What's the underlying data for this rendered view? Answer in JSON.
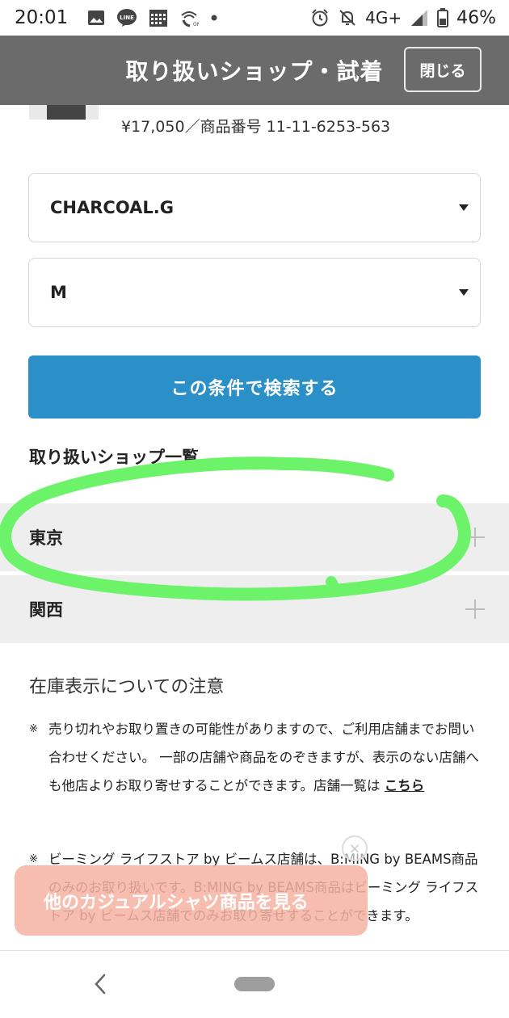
{
  "status_bar": {
    "time": "20:01",
    "network": "4G+",
    "battery": "46%",
    "icons": [
      "gallery-icon",
      "line-icon",
      "calendar-icon",
      "wifi-call-icon",
      "dot-icon",
      "alarm-icon",
      "bell-off-icon",
      "signal-icon",
      "battery-icon"
    ]
  },
  "header": {
    "title": "取り扱いショップ・試着",
    "close_label": "閉じる"
  },
  "product": {
    "price_line": "¥17,050／商品番号 11-11-6253-563"
  },
  "filters": {
    "color_value": "CHARCOAL.G",
    "size_value": "M",
    "search_label": "この条件で検索する"
  },
  "shops": {
    "title": "取り扱いショップ一覧",
    "regions": [
      {
        "label": "東京"
      },
      {
        "label": "関西"
      }
    ]
  },
  "notes": {
    "title": "在庫表示についての注意",
    "mark": "※",
    "note1_text": "売り切れやお取り置きの可能性がありますので、ご利用店舗までお問い合わせください。 一部の店舗や商品をのぞきますが、表示のない店舗へも他店よりお取り寄せすることができます。店舗一覧は ",
    "note1_link": "こちら",
    "note2_text": "ビーミング ライフストア by ビームス店舗は、B:MING by BEAMS商品のみのお取り扱いです。B:MING by BEAMS商品はビーミング ライフストア by ビームス店舗でのみお取り寄せすることができます。"
  },
  "banner": {
    "label": "他のカジュアルシャツ商品を見る",
    "close_symbol": "×"
  },
  "colors": {
    "header_bg": "#6b6b6b",
    "search_button": "#2b8fc8",
    "accordion_bg": "#eeeeee",
    "annotation_green": "#6cf36a",
    "banner_bg": "#f6b2a0"
  }
}
